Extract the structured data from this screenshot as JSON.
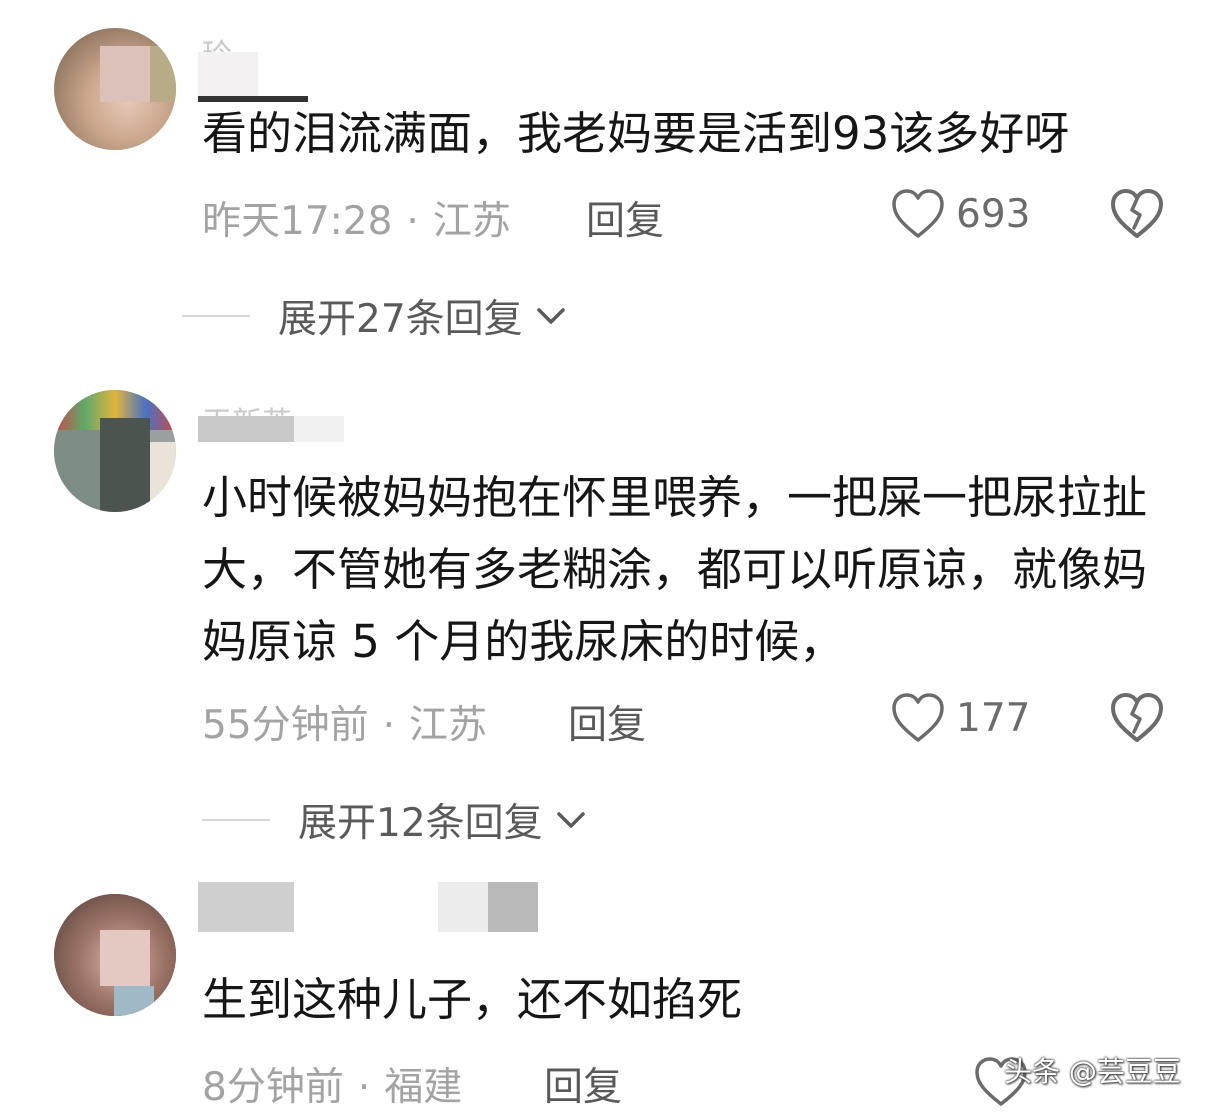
{
  "comments": [
    {
      "username": "玲",
      "text": "看的泪流满面，我老妈要是活到93该多好呀",
      "time": "昨天17:28",
      "separator": "·",
      "location": "江苏",
      "reply_label": "回复",
      "like_count": "693",
      "expand_label": "展开27条回复"
    },
    {
      "username": "王新英",
      "text": "小时候被妈妈抱在怀里喂养，一把屎一把尿拉扯大，不管她有多老糊涂，都可以听原谅，就像妈妈原谅 5 个月的我尿床的时候，",
      "time": "55分钟前",
      "separator": "·",
      "location": "江苏",
      "reply_label": "回复",
      "like_count": "177",
      "expand_label": "展开12条回复"
    },
    {
      "username": "",
      "text": "生到这种儿子，还不如掐死",
      "time": "8分钟前",
      "separator": "·",
      "location": "福建",
      "reply_label": "回复"
    }
  ],
  "icons": {
    "like": "heart-outline-icon",
    "dislike": "broken-heart-icon",
    "expand": "chevron-down-icon"
  },
  "watermark": "头条 @芸豆豆",
  "colors": {
    "text": "#161616",
    "meta": "#a3a3a3",
    "reply": "#595959",
    "icon": "#6b6b6b"
  }
}
